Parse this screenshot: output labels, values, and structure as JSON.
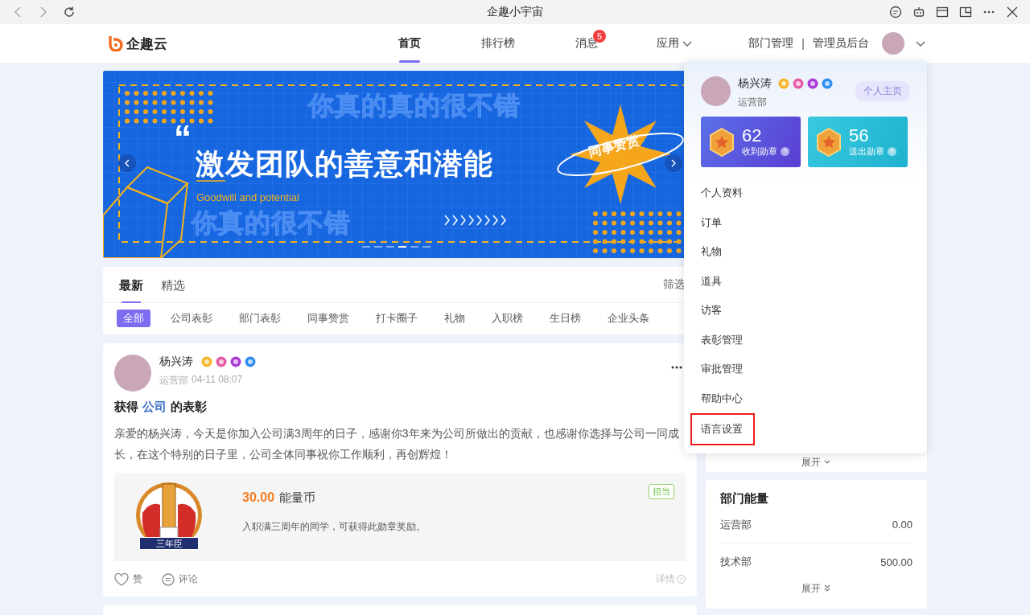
{
  "window": {
    "title": "企趣小宇宙"
  },
  "nav": {
    "logo": "企趣云",
    "tabs": [
      {
        "label": "首页",
        "selected": true
      },
      {
        "label": "排行榜",
        "selected": false
      },
      {
        "label": "消息",
        "selected": false,
        "badge": "5"
      },
      {
        "label": "应用",
        "selected": false,
        "dropdown": true
      }
    ],
    "links": [
      "部门管理",
      "管理员后台"
    ],
    "separator": "|"
  },
  "banner": {
    "outline_top": "你真的真的很不错",
    "quote": "“",
    "headline": "激发团队的善意和潜能",
    "subtitle": "Goodwill and potential",
    "outline_bottom": "你真的很不错",
    "sticker": "同事赞赏",
    "dots": [
      {
        "selected": false
      },
      {
        "selected": false
      },
      {
        "selected": false
      },
      {
        "selected": true
      },
      {
        "selected": false
      },
      {
        "selected": false
      }
    ]
  },
  "feed_tabs": [
    {
      "label": "最新",
      "selected": true
    },
    {
      "label": "精选",
      "selected": false
    }
  ],
  "filter": "筛选",
  "categories": [
    {
      "label": "全部",
      "selected": true
    },
    {
      "label": "公司表彰",
      "selected": false
    },
    {
      "label": "部门表彰",
      "selected": false
    },
    {
      "label": "同事赞赏",
      "selected": false
    },
    {
      "label": "打卡圈子",
      "selected": false
    },
    {
      "label": "礼物",
      "selected": false
    },
    {
      "label": "入职榜",
      "selected": false
    },
    {
      "label": "生日榜",
      "selected": false
    },
    {
      "label": "企业头条",
      "selected": false
    }
  ],
  "post": {
    "author": "杨兴涛",
    "dept": "运营部",
    "time": "04-11 08:07",
    "title_before": "获得",
    "title_link": "公司",
    "title_after": "的表彰",
    "body": "亲爱的杨兴涛，今天是你加入公司满3周年的日子，感谢你3年来为公司所做出的贡献，也感谢你选择与公司一同成长，在这个特别的日子里，公司全体同事祝你工作顺利，再创辉煌！",
    "reward": {
      "amount": "30.00",
      "unit": "能量币",
      "desc": "入职满三周年的同学，可获得此勋章奖励。",
      "tag": "担当",
      "medal_label": "三年臣"
    },
    "like": "赞",
    "comment": "评论",
    "detail": "详情"
  },
  "profile_menu": {
    "name": "杨兴涛",
    "dept": "运营部",
    "home_button": "个人主页",
    "stats": [
      {
        "kind": "received",
        "value": "62",
        "label": "收到勋章"
      },
      {
        "kind": "sent",
        "value": "56",
        "label": "送出勋章"
      }
    ],
    "items": [
      {
        "label": "个人资料",
        "selected": false
      },
      {
        "label": "订单",
        "selected": false
      },
      {
        "label": "礼物",
        "selected": false
      },
      {
        "label": "道具",
        "selected": false
      },
      {
        "label": "访客",
        "selected": false
      },
      {
        "label": "表彰管理",
        "selected": false
      },
      {
        "label": "审批管理",
        "selected": false
      },
      {
        "label": "帮助中心",
        "selected": false
      },
      {
        "label": "语言设置",
        "selected": true
      }
    ]
  },
  "side_card": {
    "expand": "展开"
  },
  "dept_energy": {
    "title": "部门能量",
    "rows": [
      {
        "name": "运营部",
        "value": "0.00"
      },
      {
        "name": "技术部",
        "value": "500.00"
      }
    ],
    "expand": "展开"
  }
}
